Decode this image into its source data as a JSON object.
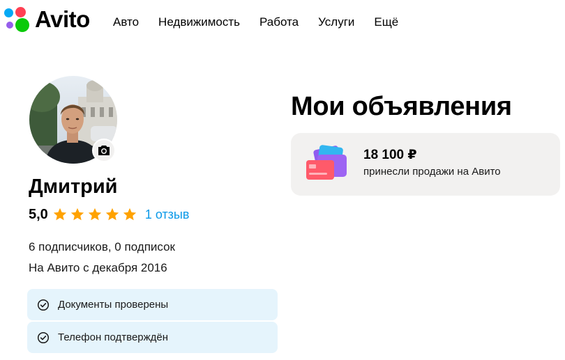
{
  "header": {
    "logo_text": "Avito",
    "nav": [
      "Авто",
      "Недвижимость",
      "Работа",
      "Услуги",
      "Ещё"
    ]
  },
  "profile": {
    "name": "Дмитрий",
    "rating": "5,0",
    "stars_filled": 5,
    "stars_total": 5,
    "reviews_link": "1 отзыв",
    "subscribers": "6 подписчиков, 0 подписок",
    "since": "На Авито с декабря 2016",
    "badges": [
      "Документы проверены",
      "Телефон подтверждён"
    ]
  },
  "listings": {
    "title": "Мои объявления",
    "sales_amount": "18 100 ₽",
    "sales_caption": "принесли продажи на Авито"
  },
  "colors": {
    "star": "#ffa200",
    "link": "#0a99e8",
    "badge_bg": "#e5f4fc",
    "card_bg": "#f2f1f0"
  }
}
